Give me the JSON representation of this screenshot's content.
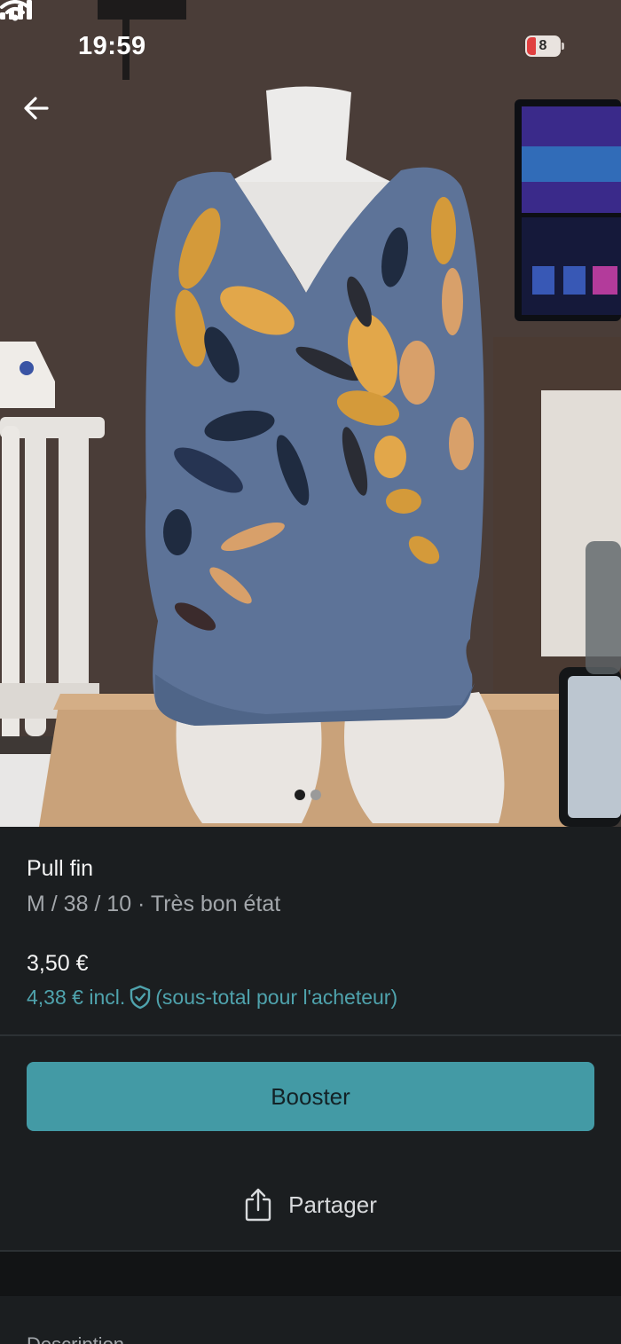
{
  "status_bar": {
    "time": "19:59",
    "battery_level": "8",
    "battery_color": "#e04040"
  },
  "photo": {
    "carousel_active_index": 0,
    "carousel_count": 2
  },
  "item": {
    "title": "Pull fin",
    "subtitle": "M / 38 / 10 · Très bon état",
    "price": "3,50 €",
    "buyer_price": "4,38 € incl.",
    "buyer_note": "(sous-total pour l'acheteur)"
  },
  "actions": {
    "booster_label": "Booster",
    "share_label": "Partager"
  },
  "description": {
    "label": "Description"
  },
  "icons": {
    "back": "arrow-left-icon",
    "protection": "shield-check-icon",
    "share": "share-icon"
  },
  "colors": {
    "accent": "#439aa5",
    "accent_text": "#4fa3ad",
    "background": "#1b1e20"
  }
}
